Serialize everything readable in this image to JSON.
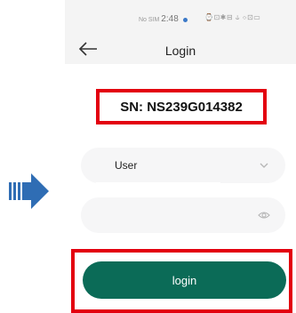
{
  "status_bar": {
    "carrier": "No SIM",
    "time": "2:48",
    "icons_text": "⌚⊡✱⊟ ⫝ ⌔⊡▭"
  },
  "header": {
    "title": "Login",
    "back_icon": "arrow-left-icon"
  },
  "serial": {
    "text": "SN: NS239G014382"
  },
  "form": {
    "user_value": "User",
    "user_icon": "chevron-down-icon",
    "password_value": "",
    "password_icon": "eye-icon"
  },
  "login": {
    "label": "login"
  },
  "colors": {
    "accent_green": "#0b6b57",
    "highlight_red": "#e3000f",
    "arrow_blue": "#2f6db4",
    "header_bg": "#f4f4f4",
    "field_bg": "#f6f6f7"
  }
}
